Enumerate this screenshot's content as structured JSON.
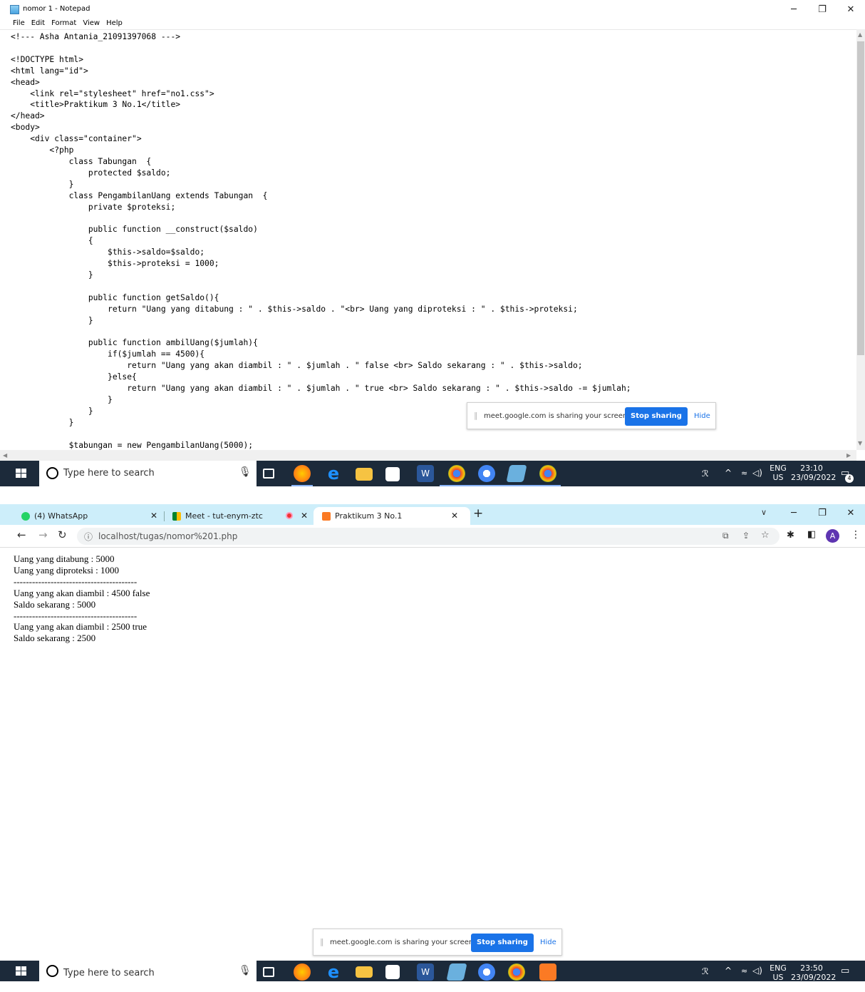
{
  "notepad": {
    "title": "nomor 1 - Notepad",
    "menu": [
      "File",
      "Edit",
      "Format",
      "View",
      "Help"
    ],
    "code": "<!--- Asha Antania_21091397068 --->\n\n<!DOCTYPE html>\n<html lang=\"id\">\n<head>\n    <link rel=\"stylesheet\" href=\"no1.css\">\n    <title>Praktikum 3 No.1</title>\n</head>\n<body>\n    <div class=\"container\">\n        <?php\n            class Tabungan  {\n                protected $saldo;\n            }\n            class PengambilanUang extends Tabungan  {\n                private $proteksi;\n\n                public function __construct($saldo)\n                {\n                    $this->saldo=$saldo;\n                    $this->proteksi = 1000;\n                }\n\n                public function getSaldo(){\n                    return \"Uang yang ditabung : \" . $this->saldo . \"<br> Uang yang diproteksi : \" . $this->proteksi;\n                }\n\n                public function ambilUang($jumlah){\n                    if($jumlah == 4500){\n                        return \"Uang yang akan diambil : \" . $jumlah . \" false <br> Saldo sekarang : \" . $this->saldo;\n                    }else{\n                        return \"Uang yang akan diambil : \" . $jumlah . \" true <br> Saldo sekarang : \" . $this->saldo -= $jumlah;\n                    }\n                }\n            }\n\n            $tabungan = new PengambilanUang(5000);"
  },
  "share_bar": {
    "message": "meet.google.com is sharing your screen.",
    "stop_label": "Stop sharing",
    "hide_label": "Hide"
  },
  "taskbar_top": {
    "search_placeholder": "Type here to search",
    "lang": "ENG",
    "region": "US",
    "time": "23:10",
    "date": "23/09/2022",
    "notif_count": "4"
  },
  "taskbar_bottom": {
    "search_placeholder": "Type here to search",
    "lang": "ENG",
    "region": "US",
    "time": "23:50",
    "date": "23/09/2022"
  },
  "chrome": {
    "tabs": [
      {
        "label": "(4) WhatsApp"
      },
      {
        "label": "Meet - tut-enym-ztc"
      },
      {
        "label": "Praktikum 3 No.1"
      }
    ],
    "url": "localhost/tugas/nomor%201.php",
    "avatar_letter": "A",
    "output": "Uang yang ditabung : 5000\nUang yang diproteksi : 1000\n----------------------------------------\nUang yang akan diambil : 4500 false\nSaldo sekarang : 5000\n----------------------------------------\nUang yang akan diambil : 2500 true\nSaldo sekarang : 2500"
  },
  "colors": {
    "accent": "#1a73e8",
    "taskbar": "#1c2a3a",
    "tabstrip": "#cdeefa"
  }
}
